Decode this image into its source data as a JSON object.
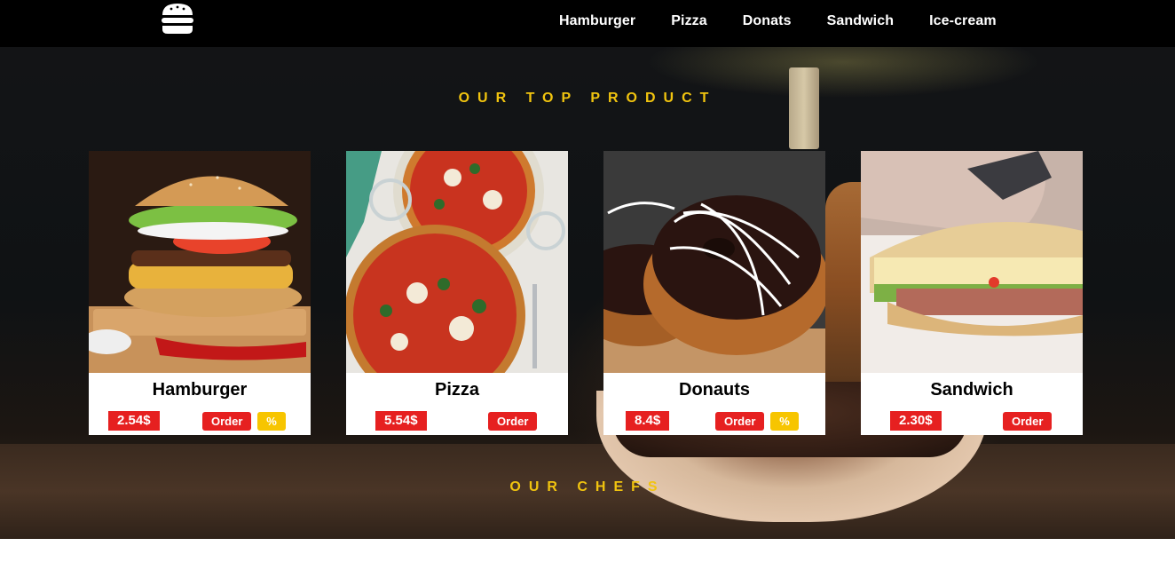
{
  "nav": {
    "logo_icon": "hamburger-logo-icon",
    "links": [
      {
        "label": "Hamburger"
      },
      {
        "label": "Pizza"
      },
      {
        "label": "Donats"
      },
      {
        "label": "Sandwich"
      },
      {
        "label": "Ice-cream"
      }
    ]
  },
  "sections": {
    "top_product_title": "OUR TOP PRODUCT",
    "chefs_title": "OUR CHEFS"
  },
  "products": [
    {
      "name": "Hamburger",
      "price": "2.54$",
      "order_label": "Order",
      "discount": "%",
      "image_icon": "hamburger-photo"
    },
    {
      "name": "Pizza",
      "price": "5.54$",
      "order_label": "Order",
      "image_icon": "pizza-photo"
    },
    {
      "name": "Donauts",
      "price": "8.4$",
      "order_label": "Order",
      "discount": "%",
      "image_icon": "donut-photo"
    },
    {
      "name": "Sandwich",
      "price": "2.30$",
      "order_label": "Order",
      "image_icon": "sandwich-photo"
    }
  ],
  "colors": {
    "accent_gold": "#f1c40f",
    "price_red": "#e62020",
    "badge_yellow": "#f7c500",
    "nav_bg": "#000000"
  }
}
